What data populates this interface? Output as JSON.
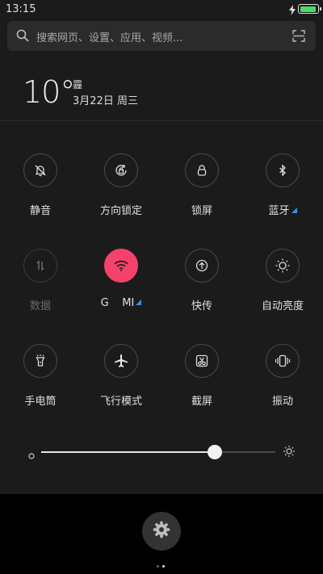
{
  "status_bar": {
    "time": "13:15",
    "battery_level": 0.95,
    "charging": true
  },
  "search": {
    "placeholder": "搜索网页、设置、应用、视频..."
  },
  "weather": {
    "temperature": "10°",
    "condition": "霾",
    "date": "3月22日 周三"
  },
  "toggles": [
    {
      "id": "mute",
      "label": "静音",
      "icon": "bell-slash-icon",
      "active": false,
      "has_more": false
    },
    {
      "id": "rotation-lock",
      "label": "方向锁定",
      "icon": "rotation-lock-icon",
      "active": false,
      "has_more": false
    },
    {
      "id": "lock-screen",
      "label": "锁屏",
      "icon": "lock-icon",
      "active": false,
      "has_more": false
    },
    {
      "id": "bluetooth",
      "label": "蓝牙",
      "icon": "bluetooth-icon",
      "active": false,
      "has_more": true
    },
    {
      "id": "data",
      "label": "数据",
      "icon": "data-arrows-icon",
      "active": false,
      "has_more": false,
      "disabled": true
    },
    {
      "id": "wifi",
      "label": "G    MI",
      "icon": "wifi-icon",
      "active": true,
      "has_more": true
    },
    {
      "id": "quick-share",
      "label": "快传",
      "icon": "upload-icon",
      "active": false,
      "has_more": false
    },
    {
      "id": "auto-brightness",
      "label": "自动亮度",
      "icon": "sun-icon",
      "active": false,
      "has_more": false
    },
    {
      "id": "flashlight",
      "label": "手电筒",
      "icon": "flashlight-icon",
      "active": false,
      "has_more": false
    },
    {
      "id": "airplane",
      "label": "飞行模式",
      "icon": "airplane-icon",
      "active": false,
      "has_more": false
    },
    {
      "id": "screenshot",
      "label": "截屏",
      "icon": "scissors-icon",
      "active": false,
      "has_more": false
    },
    {
      "id": "vibrate",
      "label": "振动",
      "icon": "vibrate-icon",
      "active": false,
      "has_more": false
    }
  ],
  "brightness": {
    "level": 0.74
  },
  "bottom": {
    "settings_icon": "gear-icon",
    "page_count": 2,
    "active_page": 2
  },
  "colors": {
    "accent_active": "#f5426c",
    "more_indicator": "#3e8ee6",
    "battery_fill": "#4cd964"
  }
}
